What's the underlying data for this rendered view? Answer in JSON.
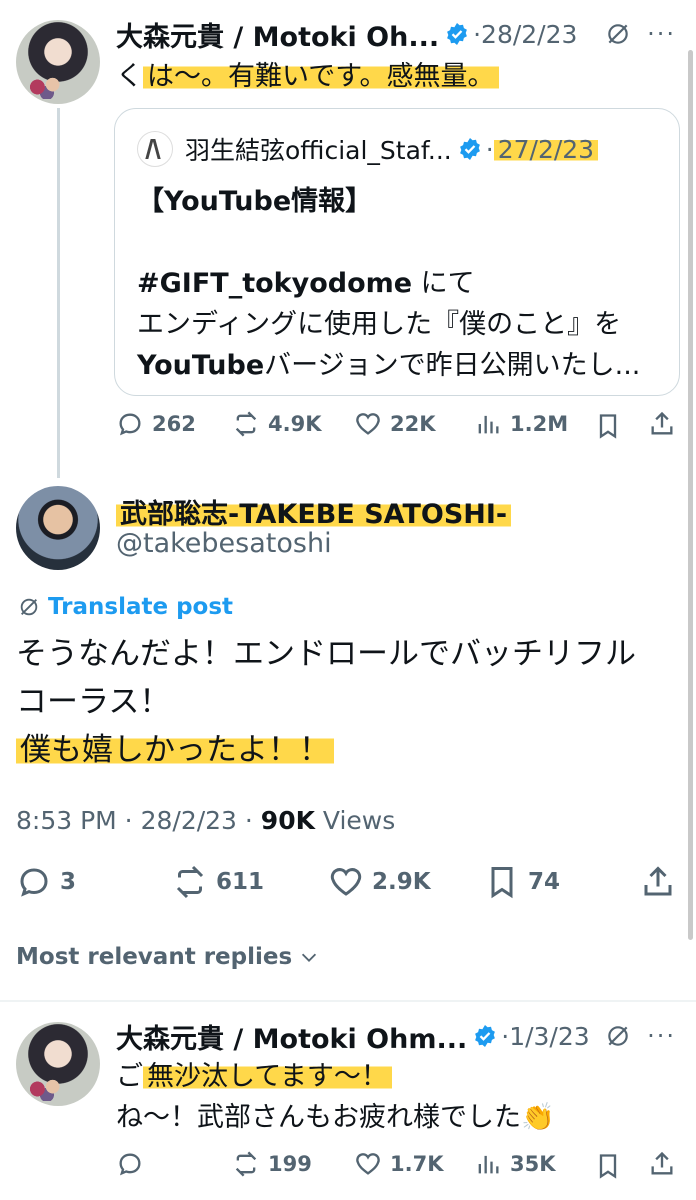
{
  "tweet1": {
    "display_name": "大森元貴 / Motoki Oh...",
    "date": "28/2/23",
    "text_prefix": "く",
    "text_highlight": "は～。有難いです。感無量。",
    "quote": {
      "display_name": "羽生結弦official_Staf...",
      "date": "27/2/23",
      "line1": "【YouTube情報】",
      "hashtag": "#GIFT_tokyodome",
      "line2_suffix": " にて",
      "line3": "エンディングに使用した『僕のこと』を",
      "line4_bold": "YouTube",
      "line4_rest": "バージョンで昨日公開いたし..."
    },
    "stats": {
      "replies": "262",
      "reposts": "4.9K",
      "likes": "22K",
      "views": "1.2M"
    }
  },
  "main_tweet": {
    "display_name": "武部聡志-TAKEBE SATOSHI-",
    "handle": "@takebesatoshi",
    "translate_label": "Translate post",
    "line1": "そうなんだよ！エンドロールでバッチリフル",
    "line2": "コーラス！",
    "line3": "僕も嬉しかったよ！！",
    "time": "8:53 PM",
    "date": "28/2/23",
    "views_count": "90K",
    "views_label": "Views",
    "stats": {
      "replies": "3",
      "reposts": "611",
      "likes": "2.9K",
      "bookmarks": "74"
    }
  },
  "replies_sort": {
    "label": "Most relevant replies"
  },
  "reply": {
    "display_name": "大森元貴 / Motoki Ohm...",
    "date": "1/3/23",
    "line1_prefix": "ご",
    "line1_highlight": "無沙汰してます～！",
    "line2": "ね～！武部さんもお疲れ様でした",
    "line2_emoji": "👏",
    "stats": {
      "replies": "",
      "reposts": "199",
      "likes": "1.7K",
      "views": "35K"
    }
  },
  "colors": {
    "accent": "#1d9bf0",
    "highlight": "#ffd84a",
    "muted": "#536471",
    "text": "#0f1419"
  },
  "icons": [
    "verified-badge-icon",
    "grok-slash-icon",
    "more-icon",
    "reply-icon",
    "repost-icon",
    "like-icon",
    "views-icon",
    "bookmark-icon",
    "share-icon",
    "translate-icon",
    "chevron-down-icon"
  ]
}
